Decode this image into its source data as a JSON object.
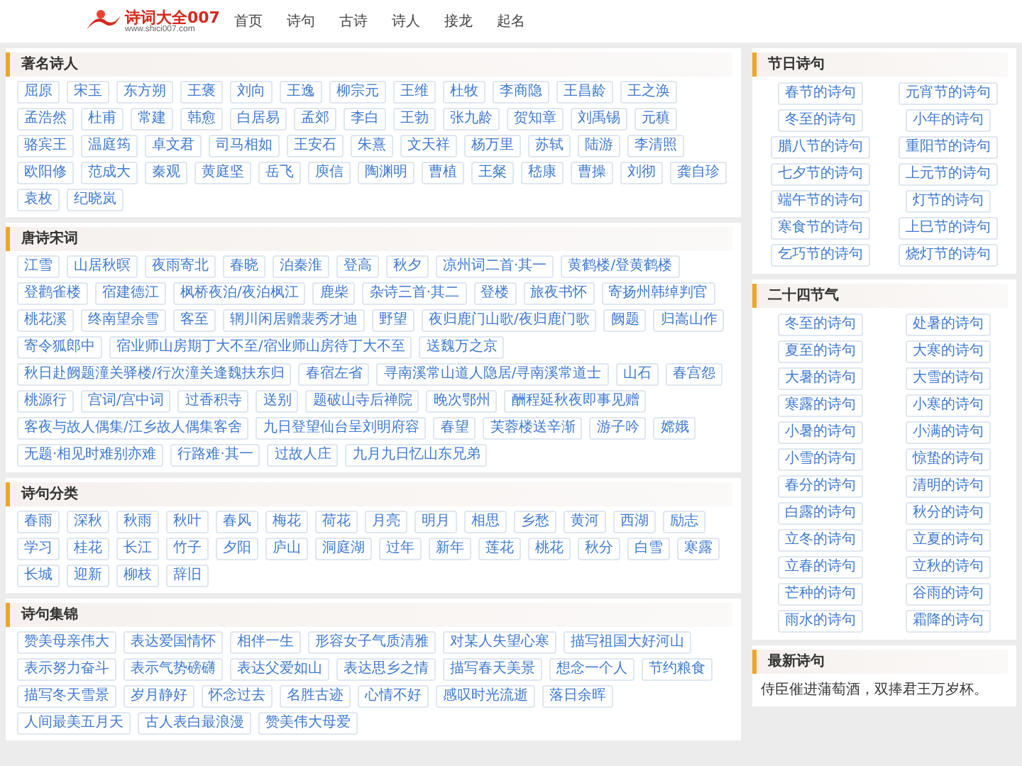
{
  "header": {
    "logo": {
      "title": "诗词大全007",
      "url": "www.shici007.com"
    },
    "nav": [
      "首页",
      "诗句",
      "古诗",
      "诗人",
      "接龙",
      "起名"
    ]
  },
  "main": [
    {
      "title": "著名诗人",
      "tags": [
        "屈原",
        "宋玉",
        "东方朔",
        "王褒",
        "刘向",
        "王逸",
        "柳宗元",
        "王维",
        "杜牧",
        "李商隐",
        "王昌龄",
        "王之涣",
        "孟浩然",
        "杜甫",
        "常建",
        "韩愈",
        "白居易",
        "孟郊",
        "李白",
        "王勃",
        "张九龄",
        "贺知章",
        "刘禹锡",
        "元稹",
        "骆宾王",
        "温庭筠",
        "卓文君",
        "司马相如",
        "王安石",
        "朱熹",
        "文天祥",
        "杨万里",
        "苏轼",
        "陆游",
        "李清照",
        "欧阳修",
        "范成大",
        "秦观",
        "黄庭坚",
        "岳飞",
        "庾信",
        "陶渊明",
        "曹植",
        "王粲",
        "嵇康",
        "曹操",
        "刘彻",
        "龚自珍",
        "袁枚",
        "纪晓岚"
      ]
    },
    {
      "title": "唐诗宋词",
      "tags": [
        "江雪",
        "山居秋暝",
        "夜雨寄北",
        "春晓",
        "泊秦淮",
        "登高",
        "秋夕",
        "凉州词二首·其一",
        "黄鹤楼/登黄鹤楼",
        "登鹳雀楼",
        "宿建德江",
        "枫桥夜泊/夜泊枫江",
        "鹿柴",
        "杂诗三首·其二",
        "登楼",
        "旅夜书怀",
        "寄扬州韩绰判官",
        "桃花溪",
        "终南望余雪",
        "客至",
        "辋川闲居赠裴秀才迪",
        "野望",
        "夜归鹿门山歌/夜归鹿门歌",
        "阙题",
        "归嵩山作",
        "寄令狐郎中",
        "宿业师山房期丁大不至/宿业师山房待丁大不至",
        "送魏万之京",
        "秋日赴阙题潼关驿楼/行次潼关逢魏扶东归",
        "春宿左省",
        "寻南溪常山道人隐居/寻南溪常道士",
        "山石",
        "春宫怨",
        "桃源行",
        "宫词/宫中词",
        "过香积寺",
        "送别",
        "题破山寺后禅院",
        "晚次鄂州",
        "酬程延秋夜即事见赠",
        "客夜与故人偶集/江乡故人偶集客舍",
        "九日登望仙台呈刘明府容",
        "春望",
        "芙蓉楼送辛渐",
        "游子吟",
        "嫦娥",
        "无题·相见时难别亦难",
        "行路难·其一",
        "过故人庄",
        "九月九日忆山东兄弟"
      ]
    },
    {
      "title": "诗句分类",
      "tags": [
        "春雨",
        "深秋",
        "秋雨",
        "秋叶",
        "春风",
        "梅花",
        "荷花",
        "月亮",
        "明月",
        "相思",
        "乡愁",
        "黄河",
        "西湖",
        "励志",
        "学习",
        "桂花",
        "长江",
        "竹子",
        "夕阳",
        "庐山",
        "洞庭湖",
        "过年",
        "新年",
        "莲花",
        "桃花",
        "秋分",
        "白雪",
        "寒露",
        "长城",
        "迎新",
        "柳枝",
        "辞旧"
      ]
    },
    {
      "title": "诗句集锦",
      "tags": [
        "赞美母亲伟大",
        "表达爱国情怀",
        "相伴一生",
        "形容女子气质清雅",
        "对某人失望心寒",
        "描写祖国大好河山",
        "表示努力奋斗",
        "表示气势磅礴",
        "表达父爱如山",
        "表达思乡之情",
        "描写春天美景",
        "想念一个人",
        "节约粮食",
        "描写冬天雪景",
        "岁月静好",
        "怀念过去",
        "名胜古迹",
        "心情不好",
        "感叹时光流逝",
        "落日余晖",
        "人间最美五月天",
        "古人表白最浪漫",
        "赞美伟大母爱"
      ]
    }
  ],
  "sidebar": [
    {
      "kind": "tags",
      "title": "节日诗句",
      "tags": [
        "春节的诗句",
        "元宵节的诗句",
        "冬至的诗句",
        "小年的诗句",
        "腊八节的诗句",
        "重阳节的诗句",
        "七夕节的诗句",
        "上元节的诗句",
        "端午节的诗句",
        "灯节的诗句",
        "寒食节的诗句",
        "上巳节的诗句",
        "乞巧节的诗句",
        "烧灯节的诗句"
      ]
    },
    {
      "kind": "tags",
      "title": "二十四节气",
      "tags": [
        "冬至的诗句",
        "处暑的诗句",
        "夏至的诗句",
        "大寒的诗句",
        "大暑的诗句",
        "大雪的诗句",
        "寒露的诗句",
        "小寒的诗句",
        "小暑的诗句",
        "小满的诗句",
        "小雪的诗句",
        "惊蛰的诗句",
        "春分的诗句",
        "清明的诗句",
        "白露的诗句",
        "秋分的诗句",
        "立冬的诗句",
        "立夏的诗句",
        "立春的诗句",
        "立秋的诗句",
        "芒种的诗句",
        "谷雨的诗句",
        "雨水的诗句",
        "霜降的诗句"
      ]
    },
    {
      "kind": "text",
      "title": "最新诗句",
      "lines": [
        "侍臣催进蒲萄酒，双捧君王万岁杯。"
      ]
    }
  ]
}
